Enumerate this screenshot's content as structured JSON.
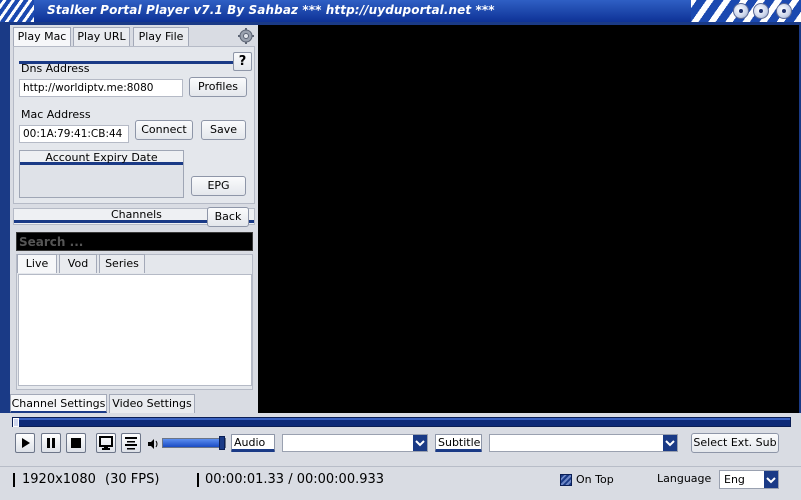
{
  "window": {
    "title": "Stalker Portal Player v7.1 By Sahbaz  *** http://uyduportal.net ***"
  },
  "tabs": {
    "play_mac": "Play Mac",
    "play_url": "Play URL",
    "play_file": "Play File"
  },
  "form": {
    "dns_label": "Dns Address",
    "dns_value": "http://worldiptv.me:8080",
    "profiles_button": "Profiles",
    "mac_label": "Mac Address",
    "mac_value": "00:1A:79:41:CB:44",
    "connect_button": "Connect",
    "save_button": "Save",
    "expiry_header": "Account Expiry Date",
    "epg_button": "EPG",
    "help_button": "?"
  },
  "channels": {
    "header": "Channels",
    "back_button": "Back",
    "search_placeholder": "Search ...",
    "tabs": [
      "Live",
      "Vod",
      "Series"
    ]
  },
  "settings_tabs": {
    "channel": "Channel Settings",
    "video": "Video Settings"
  },
  "controls": {
    "audio_label": "Audio",
    "subtitle_label": "Subtitle",
    "ext_sub_button": "Select Ext. Sub",
    "volume_level": 1.0
  },
  "status": {
    "resolution": "1920x1080",
    "fps": "(30 FPS)",
    "time": "00:00:01.33 / 00:00:00.933",
    "on_top": "On Top",
    "language_label": "Language",
    "language_value": "Eng"
  },
  "colors": {
    "window_blue": "#1a3a86",
    "panel_gray": "#d9dce3",
    "video_bg": "#000000"
  }
}
